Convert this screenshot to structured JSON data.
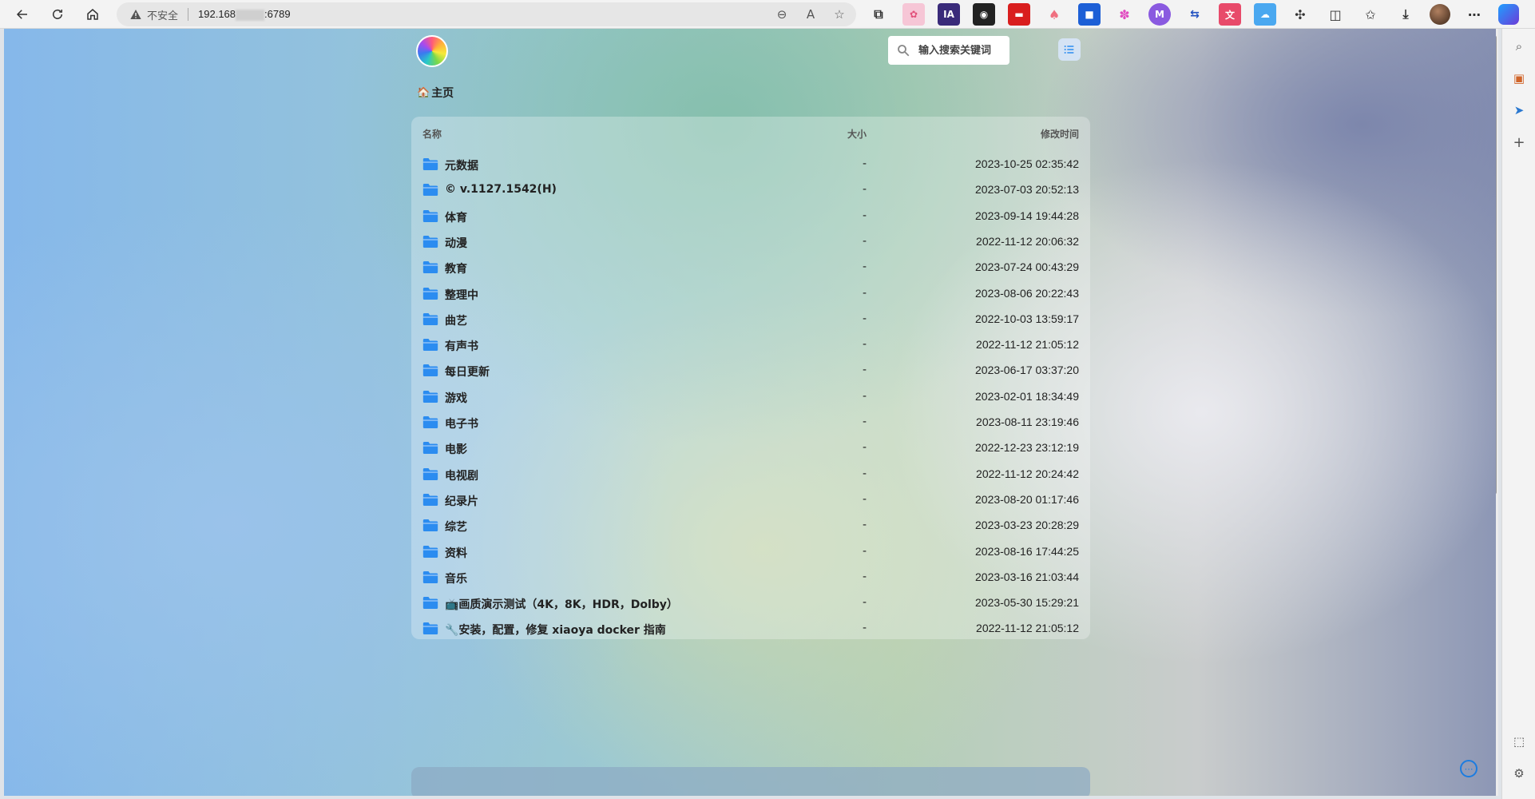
{
  "browser": {
    "insecure_label": "不安全",
    "url_prefix": "192.168",
    "url_suffix": ":6789"
  },
  "search": {
    "placeholder": "输入搜索关键词"
  },
  "breadcrumb": {
    "home_label": "主页"
  },
  "table": {
    "headers": {
      "name": "名称",
      "size": "大小",
      "modified": "修改时间"
    },
    "rows": [
      {
        "name": "元数据",
        "size": "-",
        "modified": "2023-10-25 02:35:42"
      },
      {
        "name": "© v.1127.1542(H)",
        "size": "-",
        "modified": "2023-07-03 20:52:13"
      },
      {
        "name": "体育",
        "size": "-",
        "modified": "2023-09-14 19:44:28"
      },
      {
        "name": "动漫",
        "size": "-",
        "modified": "2022-11-12 20:06:32"
      },
      {
        "name": "教育",
        "size": "-",
        "modified": "2023-07-24 00:43:29"
      },
      {
        "name": "整理中",
        "size": "-",
        "modified": "2023-08-06 20:22:43"
      },
      {
        "name": "曲艺",
        "size": "-",
        "modified": "2022-10-03 13:59:17"
      },
      {
        "name": "有声书",
        "size": "-",
        "modified": "2022-11-12 21:05:12"
      },
      {
        "name": "每日更新",
        "size": "-",
        "modified": "2023-06-17 03:37:20"
      },
      {
        "name": "游戏",
        "size": "-",
        "modified": "2023-02-01 18:34:49"
      },
      {
        "name": "电子书",
        "size": "-",
        "modified": "2023-08-11 23:19:46"
      },
      {
        "name": "电影",
        "size": "-",
        "modified": "2022-12-23 23:12:19"
      },
      {
        "name": "电视剧",
        "size": "-",
        "modified": "2022-11-12 20:24:42"
      },
      {
        "name": "纪录片",
        "size": "-",
        "modified": "2023-08-20 01:17:46"
      },
      {
        "name": "综艺",
        "size": "-",
        "modified": "2023-03-23 20:28:29"
      },
      {
        "name": "资料",
        "size": "-",
        "modified": "2023-08-16 17:44:25"
      },
      {
        "name": "音乐",
        "size": "-",
        "modified": "2023-03-16 21:03:44"
      },
      {
        "name": "📺画质演示测试（4K，8K，HDR，Dolby）",
        "size": "-",
        "modified": "2023-05-30 15:29:21"
      },
      {
        "name": "🔧安装，配置，修复 xiaoya docker 指南",
        "size": "-",
        "modified": "2022-11-12 21:05:12"
      }
    ]
  },
  "colors": {
    "folder": "#2b8cf0",
    "accent": "#1c7ce0"
  }
}
